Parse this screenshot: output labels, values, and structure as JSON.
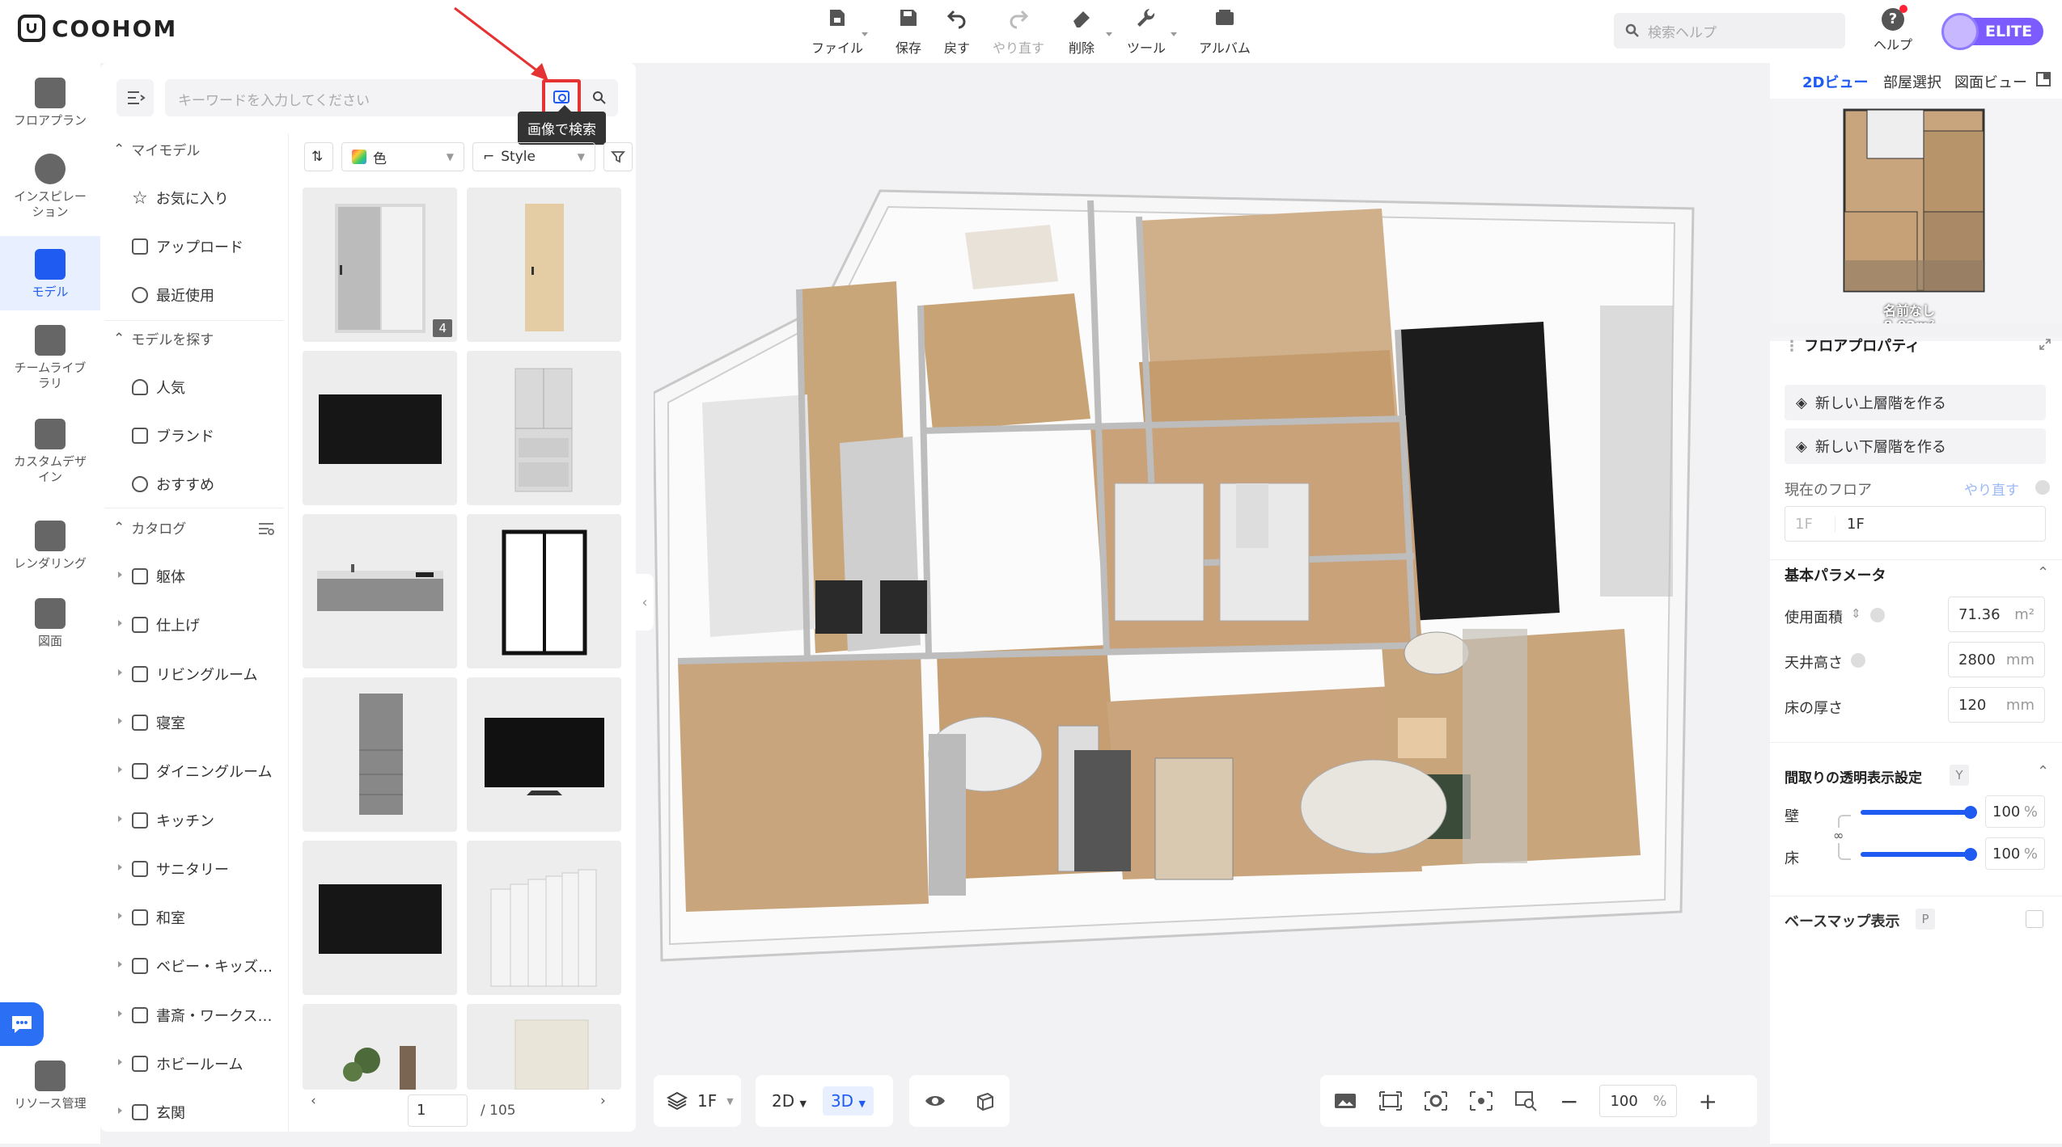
{
  "app": {
    "brand": "COOHOM"
  },
  "toolbar": {
    "file": "ファイル",
    "save": "保存",
    "undo": "戻す",
    "redo": "やり直す",
    "delete": "削除",
    "tools": "ツール",
    "album": "アルバム"
  },
  "search_help": {
    "placeholder": "検索ヘルプ"
  },
  "help": {
    "label": "ヘルプ"
  },
  "user": {
    "badge": "ELITE"
  },
  "rail": {
    "floorplan": "フロアプラン",
    "inspiration_1": "インスピレー",
    "inspiration_2": "ション",
    "model": "モデル",
    "team_1": "チームライブ",
    "team_2": "ラリ",
    "custom_1": "カスタムデザ",
    "custom_2": "イン",
    "rendering": "レンダリング",
    "drawing": "図面",
    "resource": "リソース管理"
  },
  "panel": {
    "keyword_placeholder": "キーワードを入力してください",
    "tooltip": "画像で検索",
    "my_models": "マイモデル",
    "favorites": "お気に入り",
    "upload": "アップロード",
    "recent": "最近使用",
    "find_models": "モデルを探す",
    "popular": "人気",
    "brand": "ブランド",
    "recommended": "おすすめ",
    "catalog": "カタログ",
    "categories": [
      "躯体",
      "仕上げ",
      "リビングルーム",
      "寝室",
      "ダイニングルーム",
      "キッチン",
      "サニタリー",
      "和室",
      "ベビー・キッズ…",
      "書斎・ワークス…",
      "ホビールーム",
      "玄関"
    ],
    "filter_color": "色",
    "filter_style": "Style",
    "thumb_badge": "4",
    "page_current": "1",
    "page_total": "/ 105"
  },
  "viewport": {
    "floor": "1F",
    "mode_2d": "2D",
    "mode_3d": "3D",
    "zoom_value": "100",
    "zoom_unit": "%"
  },
  "right_panel": {
    "tab_2d": "2Dビュー",
    "tab_room": "部屋選択",
    "tab_drawing": "図面ビュー",
    "minimap_name": "名前なし",
    "minimap_area": "8.92m²",
    "floor_props": "フロアプロパティ",
    "new_upper": "新しい上層階を作る",
    "new_lower": "新しい下層階を作る",
    "current_floor": "現在のフロア",
    "redo": "やり直す",
    "floor_prefix": "1F",
    "floor_name": "1F",
    "basic_params": "基本パラメータ",
    "usable_area": "使用面積",
    "usable_area_value": "71.36",
    "usable_area_unit": "m²",
    "ceiling_height": "天井高さ",
    "ceiling_height_value": "2800",
    "ceiling_height_unit": "mm",
    "floor_thickness": "床の厚さ",
    "floor_thickness_value": "120",
    "floor_thickness_unit": "mm",
    "transparency": "間取りの透明表示設定",
    "transparency_key": "Y",
    "wall": "壁",
    "wall_value": "100",
    "floor": "床",
    "floor_value": "100",
    "percent": "%",
    "basemap": "ベースマップ表示",
    "basemap_key": "P"
  },
  "colors": {
    "accent": "#1f5bf0",
    "highlight": "#e53333",
    "elite": "#7c5cff"
  }
}
